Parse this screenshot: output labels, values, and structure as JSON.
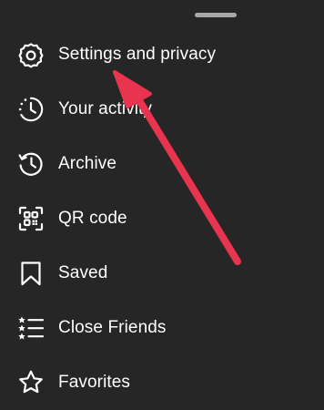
{
  "colors": {
    "background": "#262626",
    "text": "#ffffff",
    "handle": "#a8a8a8",
    "annotation_arrow": "#e8344e"
  },
  "menu": {
    "items": [
      {
        "label": "Settings and privacy",
        "icon": "gear-icon"
      },
      {
        "label": "Your activity",
        "icon": "activity-icon"
      },
      {
        "label": "Archive",
        "icon": "archive-icon"
      },
      {
        "label": "QR code",
        "icon": "qr-code-icon"
      },
      {
        "label": "Saved",
        "icon": "bookmark-icon"
      },
      {
        "label": "Close Friends",
        "icon": "close-friends-icon"
      },
      {
        "label": "Favorites",
        "icon": "star-icon"
      }
    ]
  }
}
